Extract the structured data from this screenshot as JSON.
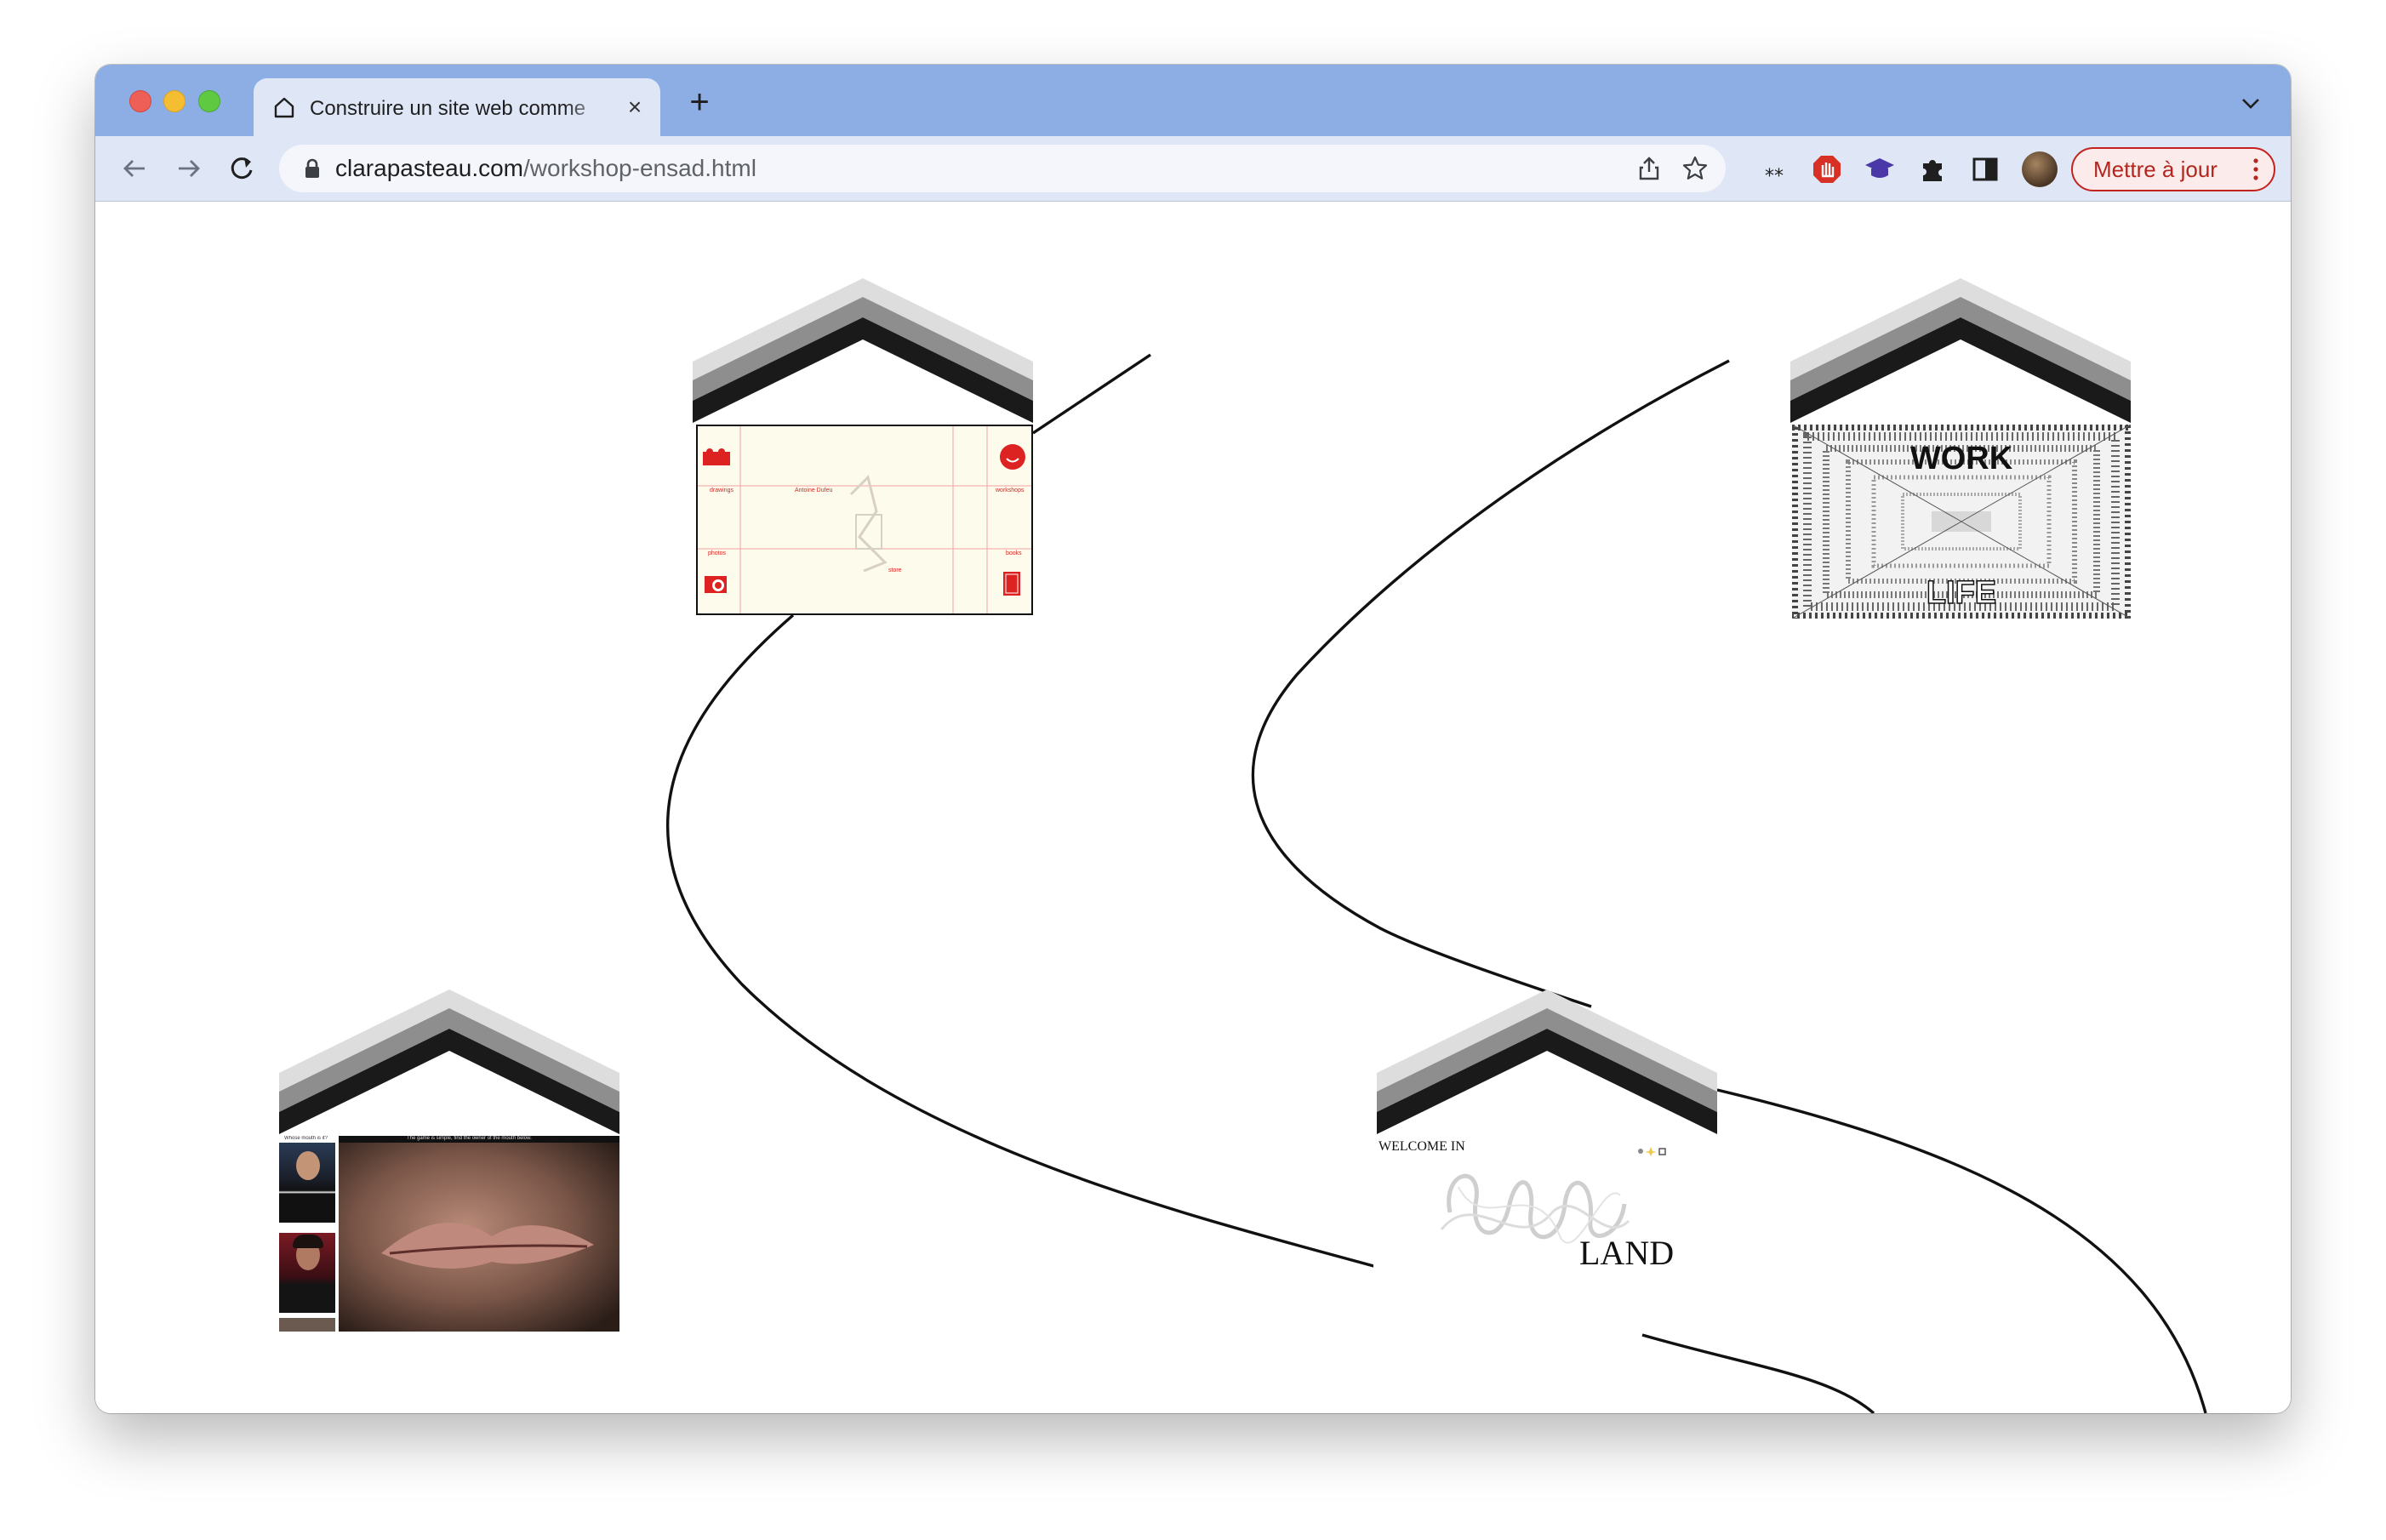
{
  "browser": {
    "tab": {
      "title": "Construire un site web comme"
    },
    "address_bar": {
      "domain": "clarapasteau.com",
      "path": "/workshop-ensad.html"
    },
    "extension_badge": "14",
    "update_button": {
      "label": "Mettre à jour"
    },
    "colors": {
      "titlebar": "#8caee4",
      "toolbar": "#dfe7f7",
      "update_accent": "#c5221f"
    }
  },
  "page": {
    "sites": [
      {
        "id": "website-map",
        "thumbnail_labels": [
          "drawings",
          "Antoine Dufeu",
          "workshops",
          "photos",
          "books",
          "store"
        ]
      },
      {
        "id": "work-life",
        "top_word": "WORK",
        "bottom_word": "LIFE"
      },
      {
        "id": "whose-mouth",
        "header": "Whose mouth is it?",
        "instruction": "The game is simple, find the owner of the mouth below."
      },
      {
        "id": "welcome-land",
        "welcome": "WELCOME IN",
        "word": "LAND"
      }
    ]
  }
}
